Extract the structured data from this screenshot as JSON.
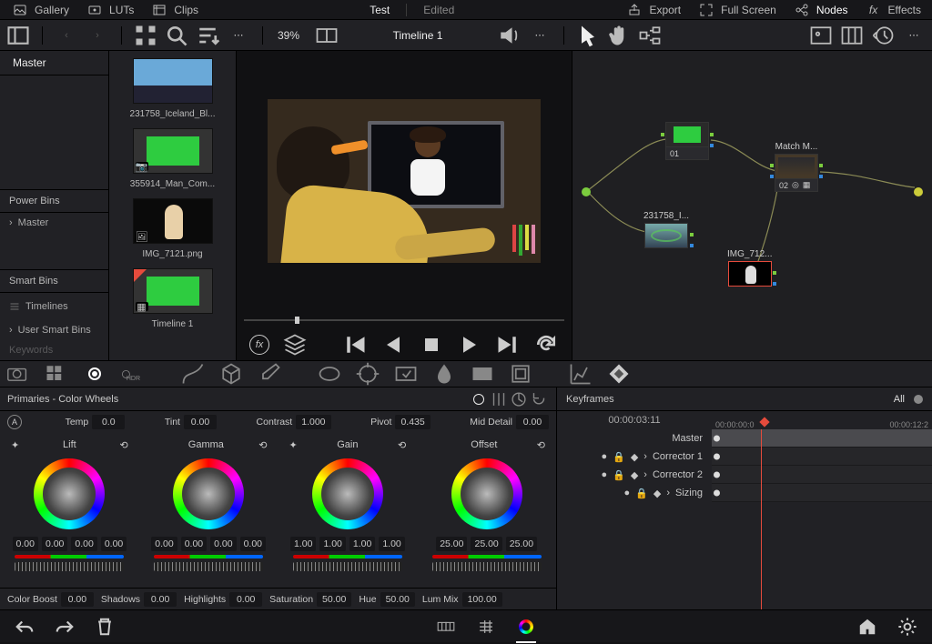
{
  "top": {
    "gallery": "Gallery",
    "luts": "LUTs",
    "clips": "Clips",
    "project": "Test",
    "status": "Edited",
    "export": "Export",
    "fullscreen": "Full Screen",
    "nodes": "Nodes",
    "effects": "Effects"
  },
  "sec": {
    "zoom": "39%",
    "timeline_name": "Timeline 1"
  },
  "sidebar": {
    "master": "Master",
    "power_bins": "Power Bins",
    "power_master": "Master",
    "smart_bins": "Smart Bins",
    "timelines": "Timelines",
    "usb": "User Smart Bins",
    "keywords": "Keywords"
  },
  "pool": [
    {
      "name": "231758_Iceland_Bl..."
    },
    {
      "name": "355914_Man_Com..."
    },
    {
      "name": "IMG_7121.png"
    },
    {
      "name": "Timeline 1",
      "timeline": true
    }
  ],
  "nodes": {
    "n1": {
      "label": "",
      "num": "01"
    },
    "n2": {
      "label": "Match M...",
      "num": "02"
    },
    "n_src": {
      "label": "231758_I..."
    },
    "n_img": {
      "label": "IMG_712..."
    }
  },
  "panel": {
    "title": "Primaries - Color Wheels",
    "temp": "Temp",
    "temp_v": "0.0",
    "tint": "Tint",
    "tint_v": "0.00",
    "contrast": "Contrast",
    "contrast_v": "1.000",
    "pivot": "Pivot",
    "pivot_v": "0.435",
    "mid": "Mid Detail",
    "mid_v": "0.00",
    "wheels": [
      {
        "name": "Lift",
        "vals": [
          "0.00",
          "0.00",
          "0.00",
          "0.00"
        ]
      },
      {
        "name": "Gamma",
        "vals": [
          "0.00",
          "0.00",
          "0.00",
          "0.00"
        ]
      },
      {
        "name": "Gain",
        "vals": [
          "1.00",
          "1.00",
          "1.00",
          "1.00"
        ]
      },
      {
        "name": "Offset",
        "vals": [
          "25.00",
          "25.00",
          "25.00"
        ]
      }
    ],
    "boost": "Color Boost",
    "boost_v": "0.00",
    "shad": "Shadows",
    "shad_v": "0.00",
    "hl": "Highlights",
    "hl_v": "0.00",
    "sat": "Saturation",
    "sat_v": "50.00",
    "hue": "Hue",
    "hue_v": "50.00",
    "lum": "Lum Mix",
    "lum_v": "100.00"
  },
  "kf": {
    "title": "Keyframes",
    "all": "All",
    "tc": "00:00:03:11",
    "ruler": [
      "00:00:00:0",
      "00:00:12:2"
    ],
    "rows": [
      "Master",
      "Corrector 1",
      "Corrector 2",
      "Sizing"
    ]
  }
}
